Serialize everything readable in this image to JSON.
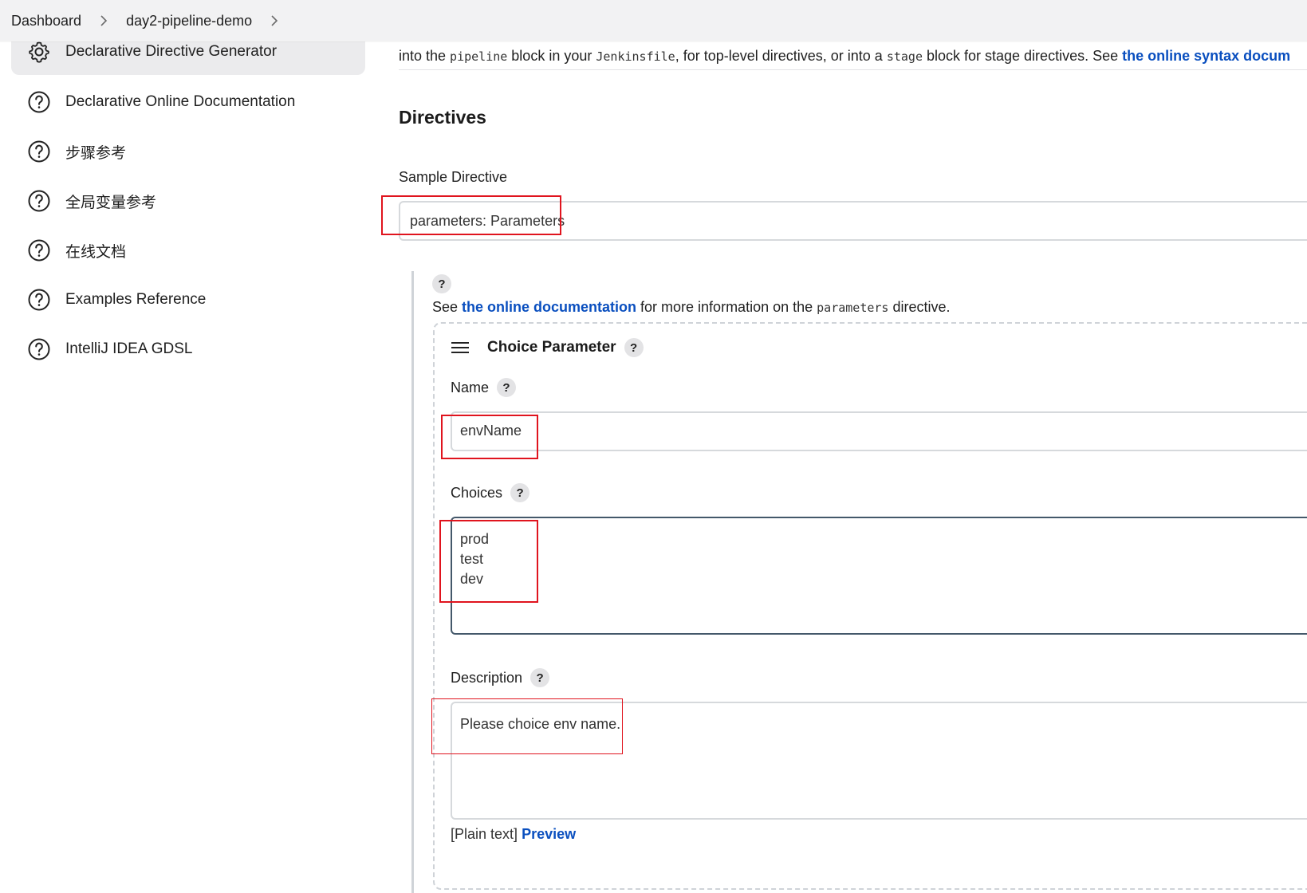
{
  "breadcrumb": {
    "items": [
      "Dashboard",
      "day2-pipeline-demo"
    ]
  },
  "sidebar": {
    "items": [
      {
        "label": "Declarative Directive Generator",
        "icon": "gear-icon",
        "active": true
      },
      {
        "label": "Declarative Online Documentation",
        "icon": "help-circle-icon"
      },
      {
        "label": "步骤参考",
        "icon": "help-circle-icon"
      },
      {
        "label": "全局变量参考",
        "icon": "help-circle-icon"
      },
      {
        "label": "在线文档",
        "icon": "help-circle-icon"
      },
      {
        "label": "Examples Reference",
        "icon": "help-circle-icon"
      },
      {
        "label": "IntelliJ IDEA GDSL",
        "icon": "help-circle-icon"
      }
    ]
  },
  "main": {
    "intro": {
      "part1": "into the ",
      "code1": "pipeline",
      "part2": " block in your ",
      "code2": "Jenkinsfile",
      "part3": ", for top-level directives, or into a ",
      "code3": "stage",
      "part4": " block for stage directives. See ",
      "link": "the online syntax docum"
    },
    "heading": "Directives",
    "sample_directive_label": "Sample Directive",
    "sample_directive_value": "parameters: Parameters",
    "help_symbol": "?",
    "see": {
      "prefix": "See ",
      "link": "the online documentation",
      "middle": " for more information on the ",
      "code": "parameters",
      "suffix": " directive."
    },
    "parameter": {
      "title": "Choice Parameter",
      "name_label": "Name",
      "name_value": "envName",
      "choices_label": "Choices",
      "choices": [
        "prod",
        "test",
        "dev"
      ],
      "description_label": "Description",
      "description_value": "Please choice env name.",
      "plain_text": "[Plain text]",
      "preview_link": "Preview"
    }
  },
  "colors": {
    "link": "#0a4fbf",
    "highlight": "#e0141e",
    "topbar": "#f2f2f3"
  }
}
